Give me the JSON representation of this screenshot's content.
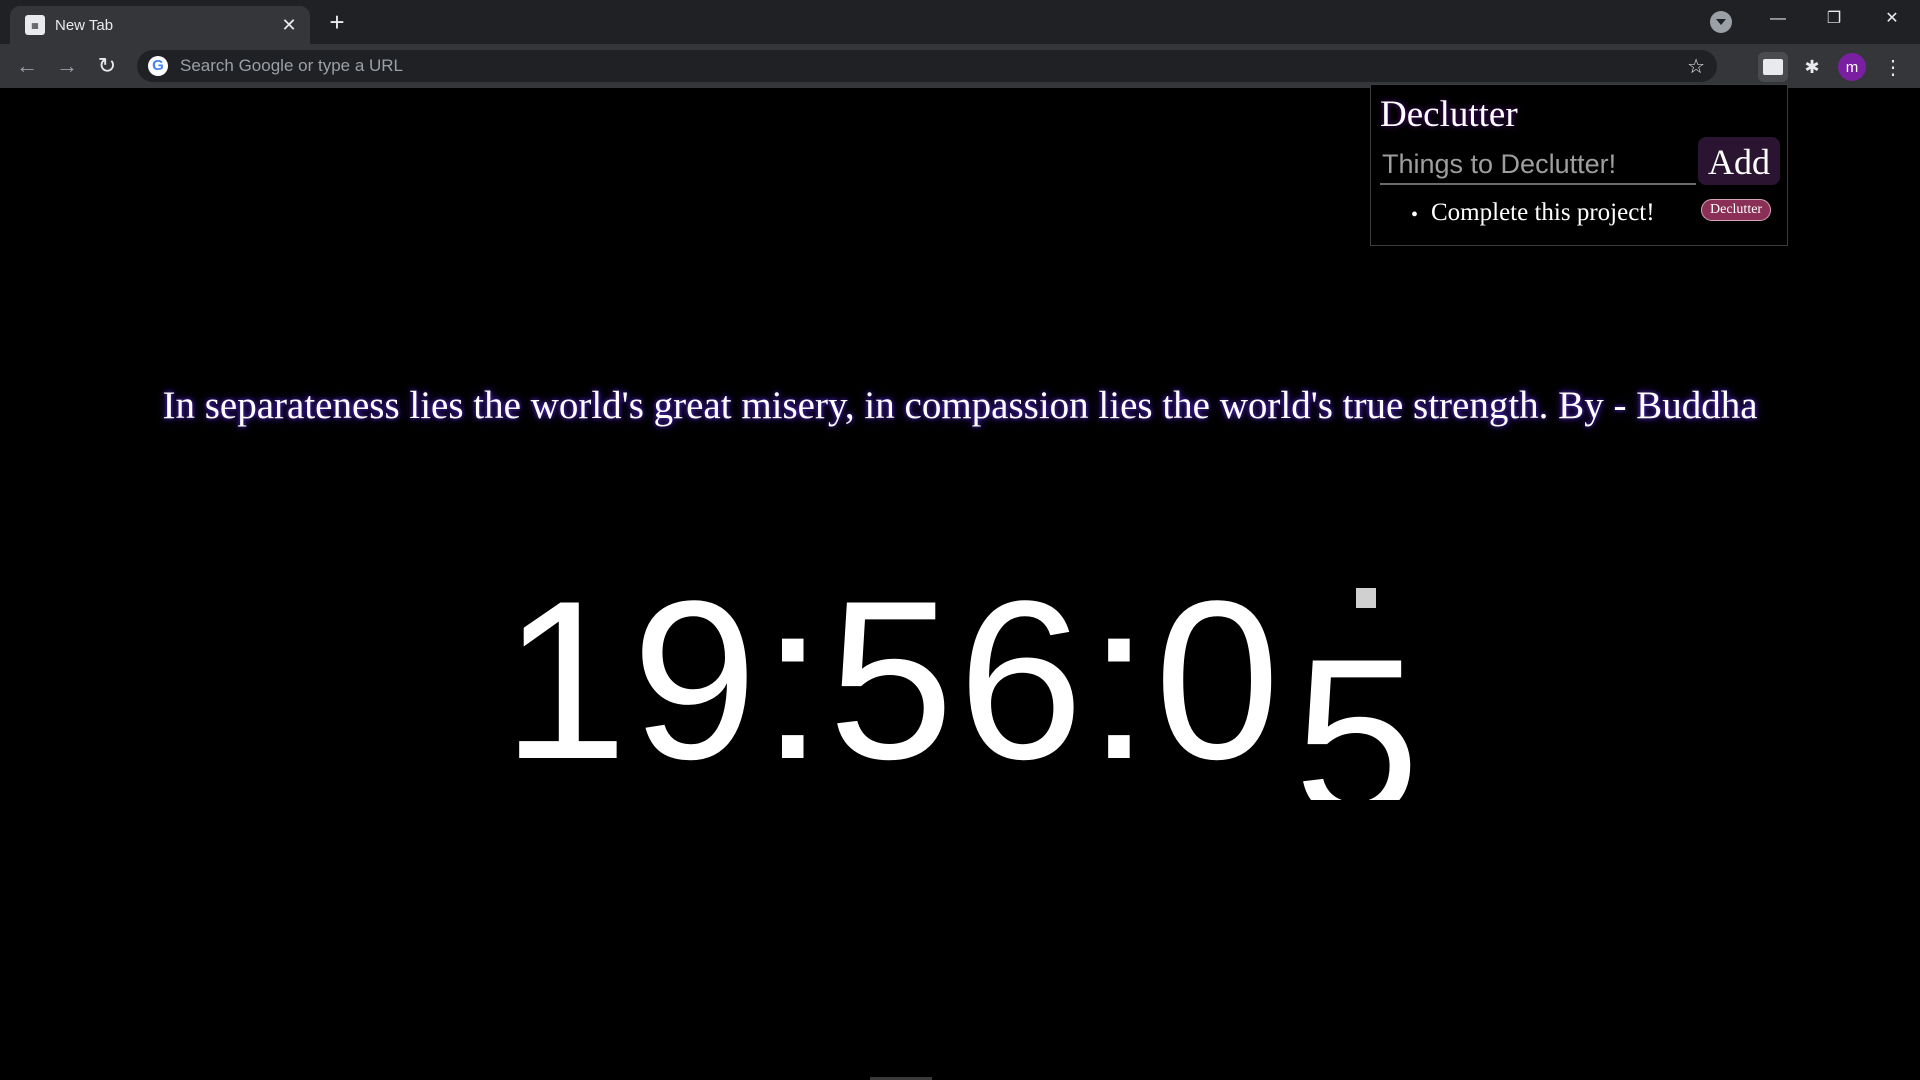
{
  "browser": {
    "tab": {
      "title": "New Tab",
      "favicon": "declutter-favicon",
      "close": "✕"
    },
    "new_tab": "+",
    "window": {
      "minimize": "—",
      "maximize": "❐",
      "close": "✕"
    },
    "nav": {
      "back": "←",
      "forward": "→",
      "reload": "↻"
    },
    "omnibox": {
      "placeholder": "Search Google or type a URL",
      "icon": "G"
    },
    "bookmark_star": "☆",
    "extensions": {
      "puzzle": "✱",
      "avatar_letter": "m",
      "menu": "⋮"
    }
  },
  "popup": {
    "title": "Declutter",
    "input_placeholder": "Things to Declutter!",
    "add_label": "Add",
    "items": [
      {
        "bullet": "•",
        "text": "Complete this project!",
        "button": "Declutter"
      }
    ]
  },
  "main": {
    "quote": "In separateness lies the world's great misery, in compassion lies the world's true strength. By - Buddha",
    "clock": {
      "main": "19:56:0",
      "rolling_digit": "5"
    }
  },
  "colors": {
    "tabstrip": "#202124",
    "toolbar": "#35363a",
    "avatar": "#7b1fa2",
    "declutter_button": "#8a2f55",
    "add_button": "#2a1432"
  }
}
